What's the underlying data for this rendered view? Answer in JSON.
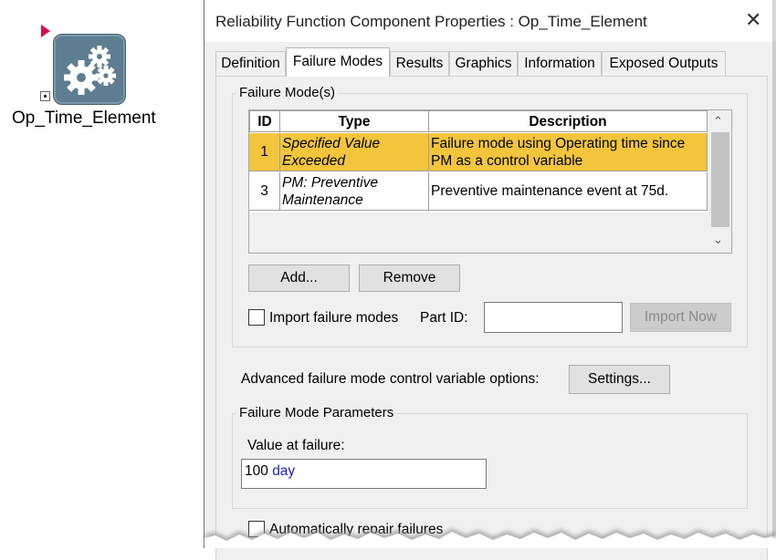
{
  "canvas": {
    "element_label": "Op_Time_Element",
    "element_icon": "gears-icon"
  },
  "dialog": {
    "title": "Reliability Function Component Properties : Op_Time_Element",
    "close_glyph": "✕",
    "tabs": [
      {
        "label": "Definition",
        "active": false
      },
      {
        "label": "Failure Modes",
        "active": true
      },
      {
        "label": "Results",
        "active": false
      },
      {
        "label": "Graphics",
        "active": false
      },
      {
        "label": "Information",
        "active": false
      },
      {
        "label": "Exposed Outputs",
        "active": false
      }
    ],
    "failure_modes": {
      "group_title": "Failure Mode(s)",
      "columns": [
        "ID",
        "Type",
        "Description"
      ],
      "rows": [
        {
          "id": "1",
          "type": "Specified Value Exceeded",
          "description": "Failure mode using Operating time since PM as a control variable",
          "selected": true
        },
        {
          "id": "3",
          "type": "PM: Preventive Maintenance",
          "description": "Preventive maintenance event at 75d.",
          "selected": false
        }
      ],
      "add_label": "Add...",
      "remove_label": "Remove",
      "import_label": "Import failure modes",
      "import_checked": false,
      "part_id_label": "Part ID:",
      "part_id_value": "",
      "import_now_label": "Import Now",
      "highlight_color": "#f2c53c"
    },
    "advanced": {
      "label": "Advanced failure mode control variable options:",
      "settings_label": "Settings..."
    },
    "parameters": {
      "group_title": "Failure Mode Parameters",
      "value_label": "Value at failure:",
      "value_number": "100",
      "value_unit": "day"
    },
    "auto_repair": {
      "label": "Automatically repair failures",
      "checked": false
    }
  }
}
